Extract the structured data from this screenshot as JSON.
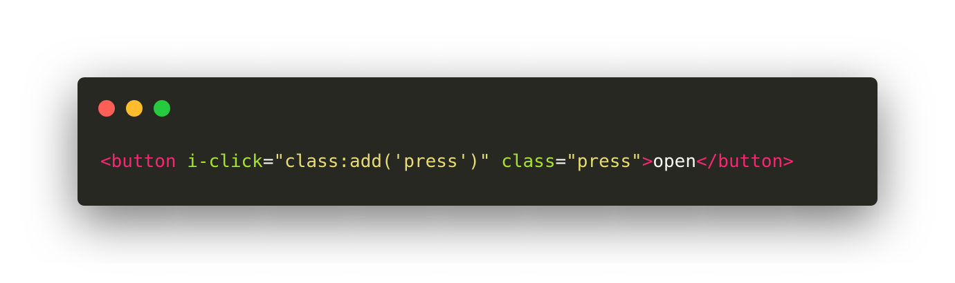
{
  "colors": {
    "background": "#ffffff",
    "window": "#272822",
    "close": "#ff5f56",
    "minimize": "#ffbd2e",
    "zoom": "#27c93f",
    "tag": "#f92672",
    "attribute": "#a6e22e",
    "string": "#e6db74",
    "text": "#f8f8f2"
  },
  "code": {
    "tokens": [
      {
        "kind": "tag",
        "text": "<button"
      },
      {
        "kind": "text",
        "text": " "
      },
      {
        "kind": "attr",
        "text": "i-click"
      },
      {
        "kind": "punct",
        "text": "="
      },
      {
        "kind": "str",
        "text": "\"class:add('press')\""
      },
      {
        "kind": "text",
        "text": " "
      },
      {
        "kind": "attr",
        "text": "class"
      },
      {
        "kind": "punct",
        "text": "="
      },
      {
        "kind": "str",
        "text": "\"press\""
      },
      {
        "kind": "tag",
        "text": ">"
      },
      {
        "kind": "text",
        "text": "open"
      },
      {
        "kind": "tag",
        "text": "</button>"
      }
    ]
  }
}
